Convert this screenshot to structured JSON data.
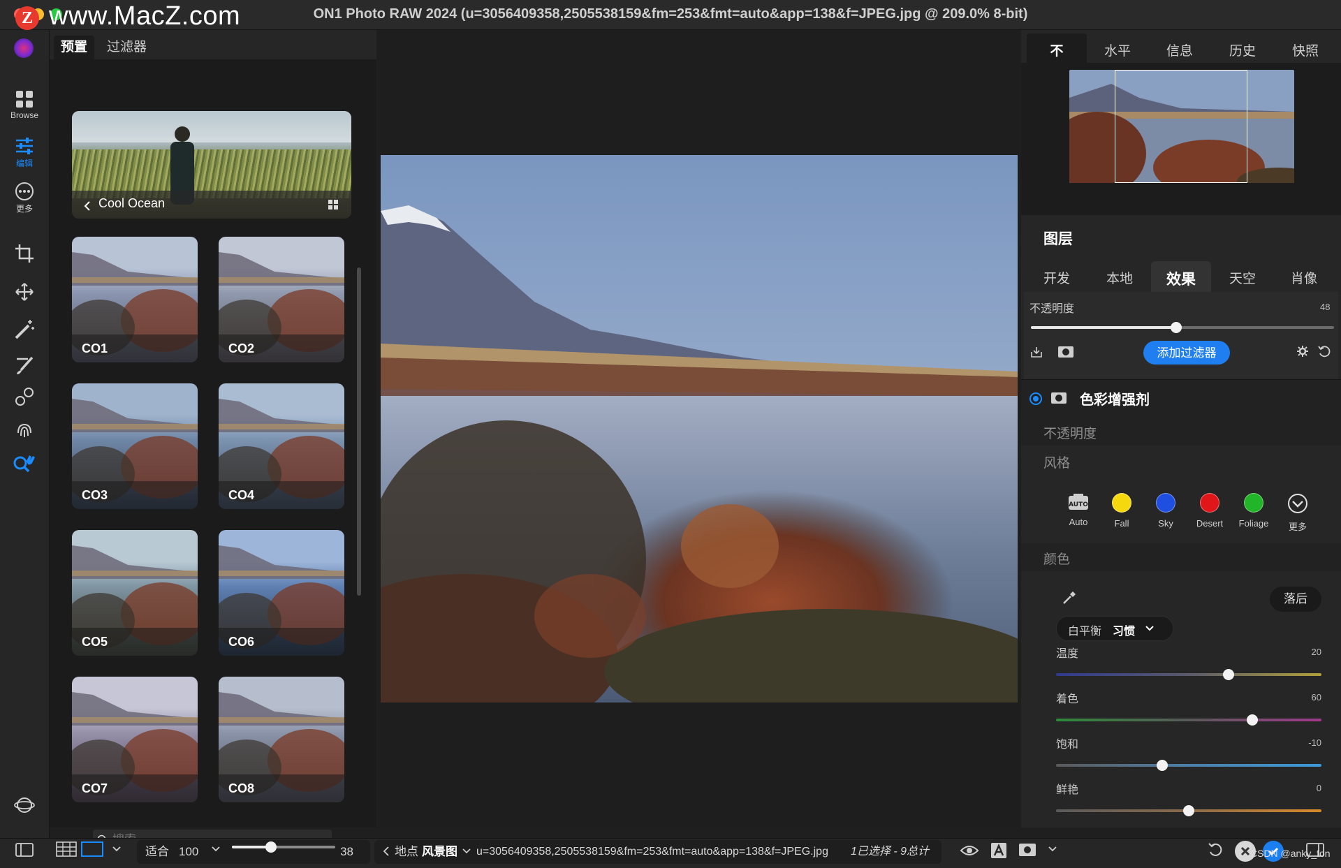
{
  "window": {
    "title": "ON1 Photo RAW 2024 (u=3056409358,2505538159&fm=253&fmt=auto&app=138&f=JPEG.jpg @ 209.0% 8-bit)",
    "watermark_logo": "Z",
    "watermark_text": "www.MacZ.com"
  },
  "toolbar": {
    "browse_label": "Browse",
    "edit_label": "编辑",
    "more_label": "更多"
  },
  "presets": {
    "tabs": [
      "预置",
      "过滤器"
    ],
    "category": "Cool Ocean",
    "items": [
      "CO1",
      "CO2",
      "CO3",
      "CO4",
      "CO5",
      "CO6",
      "CO7",
      "CO8"
    ],
    "search_placeholder": "搜索"
  },
  "right": {
    "top_tabs": [
      "不",
      "水平",
      "信息",
      "历史",
      "快照"
    ],
    "layers_title": "图层",
    "module_tabs": [
      "开发",
      "本地",
      "效果",
      "天空",
      "肖像"
    ],
    "opacity_label": "不透明度",
    "opacity_value": "48",
    "opacity_fraction": 0.48,
    "add_filter_label": "添加过滤器",
    "filter_name": "色彩增强剂",
    "filter_opacity_label": "不透明度",
    "style_label": "风格",
    "styles": [
      {
        "label": "Auto",
        "icon": "auto-icon"
      },
      {
        "label": "Fall",
        "color": "#f5d90e"
      },
      {
        "label": "Sky",
        "color": "#1f4fe0"
      },
      {
        "label": "Desert",
        "color": "#e0161b"
      },
      {
        "label": "Foliage",
        "color": "#22b429"
      },
      {
        "label": "更多",
        "icon": "chevron-circle-icon"
      }
    ],
    "color_label": "颜色",
    "fall_button": "落后",
    "wb_label": "白平衡",
    "wb_value": "习惯",
    "sliders": [
      {
        "label": "温度",
        "value": "20",
        "fraction": 0.65
      },
      {
        "label": "着色",
        "value": "60",
        "fraction": 0.74
      },
      {
        "label": "饱和",
        "value": "-10",
        "fraction": 0.4
      },
      {
        "label": "鲜艳",
        "value": "0",
        "fraction": 0.5
      }
    ]
  },
  "bottom": {
    "fit_label": "适合",
    "zoom_value": "100",
    "thumb_size_value": "38",
    "breadcrumb_back": "地点",
    "breadcrumb_folder": "风景图",
    "filename": "u=3056409358,2505538159&fm=253&fmt=auto&app=138&f=JPEG.jpg",
    "selection_info": "1已选择 - 9总计",
    "watermark": "CSDN @anky_fon"
  }
}
